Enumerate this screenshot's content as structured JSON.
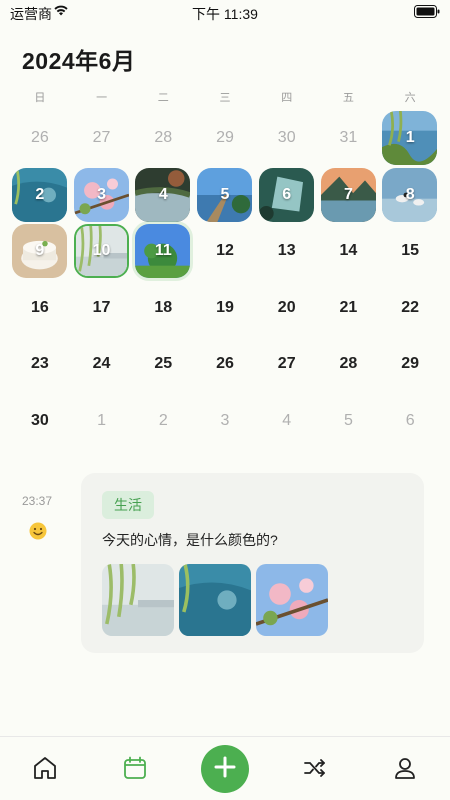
{
  "status_bar": {
    "carrier": "运营商",
    "time": "下午 11:39"
  },
  "calendar": {
    "month_title": "2024年6月",
    "weekdays": [
      "日",
      "一",
      "二",
      "三",
      "四",
      "五",
      "六"
    ],
    "days": [
      {
        "n": "26",
        "other": true
      },
      {
        "n": "27",
        "other": true
      },
      {
        "n": "28",
        "other": true
      },
      {
        "n": "29",
        "other": true
      },
      {
        "n": "30",
        "other": true
      },
      {
        "n": "31",
        "other": true
      },
      {
        "n": "1",
        "photo": "lake-willow"
      },
      {
        "n": "2",
        "photo": "teal-water"
      },
      {
        "n": "3",
        "photo": "blossom"
      },
      {
        "n": "4",
        "photo": "dark-lake"
      },
      {
        "n": "5",
        "photo": "pier"
      },
      {
        "n": "6",
        "photo": "leaf-water"
      },
      {
        "n": "7",
        "photo": "mountain-lake"
      },
      {
        "n": "8",
        "photo": "ducks"
      },
      {
        "n": "9",
        "photo": "cake"
      },
      {
        "n": "10",
        "photo": "willow-mist",
        "selected": true
      },
      {
        "n": "11",
        "photo": "tree-sky",
        "today": true
      },
      {
        "n": "12"
      },
      {
        "n": "13"
      },
      {
        "n": "14"
      },
      {
        "n": "15"
      },
      {
        "n": "16"
      },
      {
        "n": "17"
      },
      {
        "n": "18"
      },
      {
        "n": "19"
      },
      {
        "n": "20"
      },
      {
        "n": "21"
      },
      {
        "n": "22"
      },
      {
        "n": "23"
      },
      {
        "n": "24"
      },
      {
        "n": "25"
      },
      {
        "n": "26"
      },
      {
        "n": "27"
      },
      {
        "n": "28"
      },
      {
        "n": "29"
      },
      {
        "n": "30"
      },
      {
        "n": "1",
        "other": true
      },
      {
        "n": "2",
        "other": true
      },
      {
        "n": "3",
        "other": true
      },
      {
        "n": "4",
        "other": true
      },
      {
        "n": "5",
        "other": true
      },
      {
        "n": "6",
        "other": true
      }
    ]
  },
  "entry": {
    "time": "23:37",
    "mood_icon": "smile-emoji-icon",
    "tag": "生活",
    "text": "今天的心情，是什么颜色的?",
    "photos": [
      "willow-mist",
      "teal-water",
      "blossom"
    ]
  },
  "tab_bar": {
    "items": [
      {
        "name": "tab-home",
        "icon": "home-icon"
      },
      {
        "name": "tab-calendar",
        "icon": "calendar-icon",
        "active": true
      },
      {
        "name": "add-entry-button",
        "icon": "plus-icon"
      },
      {
        "name": "tab-shuffle",
        "icon": "shuffle-icon"
      },
      {
        "name": "tab-profile",
        "icon": "user-icon"
      }
    ]
  },
  "colors": {
    "accent": "#4caf50",
    "background": "#fbfcf7",
    "card": "#f2f3ef",
    "tag_bg": "#dbeedd",
    "tag_text": "#46a050"
  }
}
